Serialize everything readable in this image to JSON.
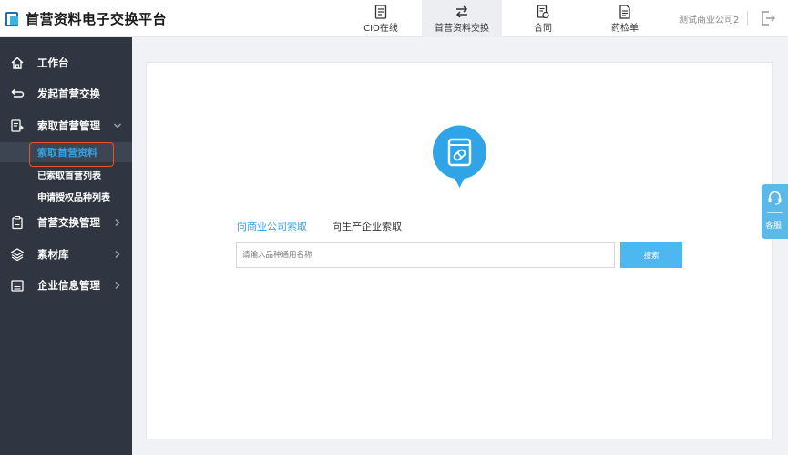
{
  "app": {
    "title": "首营资料电子交换平台"
  },
  "top_nav": [
    {
      "label": "CIO在线",
      "icon": "document-icon"
    },
    {
      "label": "首营资料交换",
      "icon": "exchange-arrows-icon",
      "active": true
    },
    {
      "label": "合同",
      "icon": "contract-icon"
    },
    {
      "label": "药检单",
      "icon": "report-icon"
    }
  ],
  "user": {
    "company": "测试商业公司2"
  },
  "sidebar": {
    "items": [
      {
        "label": "工作台",
        "icon": "home-icon"
      },
      {
        "label": "发起首营交换",
        "icon": "cycle-icon"
      },
      {
        "label": "索取首营管理",
        "icon": "request-doc-icon",
        "expanded": true
      },
      {
        "label": "首营交换管理",
        "icon": "clipboard-icon"
      },
      {
        "label": "素材库",
        "icon": "layers-icon"
      },
      {
        "label": "企业信息管理",
        "icon": "building-icon"
      }
    ],
    "sub_items": [
      {
        "label": "索取首营资料",
        "selected": true
      },
      {
        "label": "已索取首营列表"
      },
      {
        "label": "申请授权品种列表"
      }
    ]
  },
  "main": {
    "icon": "pill-box-icon",
    "tabs": [
      {
        "label": "向商业公司索取",
        "active": true
      },
      {
        "label": "向生产企业索取"
      }
    ],
    "search": {
      "placeholder": "请输入品种通用名称",
      "value": "",
      "button_label": "搜索"
    }
  },
  "customer_service": {
    "label": "客服"
  },
  "colors": {
    "accent": "#2fa4e7",
    "sidebar_bg": "#2f3541",
    "highlight": "#e8542d",
    "button": "#4db8f0"
  }
}
